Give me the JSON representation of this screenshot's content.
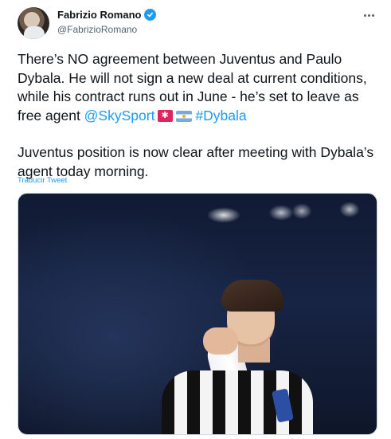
{
  "author": {
    "display_name": "Fabrizio Romano",
    "handle": "@FabrizioRomano",
    "verified": true,
    "avatar_icon": "profile-avatar"
  },
  "menu": {
    "more_icon": "more-horizontal-icon"
  },
  "tweet": {
    "para1_text": "There’s NO agreement between Juventus and Paulo Dybala. He will not sign a new deal at current conditions, while his contract runs out in June - he’s set to leave as free agent ",
    "mention": "@SkySport",
    "hashtag": "#Dybala",
    "emojis": [
      "siren-emoji",
      "argentina-flag-emoji"
    ],
    "para2_text": "Juventus position is now clear after meeting with Dybala’s agent today morning."
  },
  "translate_label": "Traducir Tweet",
  "media": {
    "description_icon": "photo-media"
  },
  "colors": {
    "link": "#1d9bf0",
    "verified": "#1d9bf0",
    "text": "#0f1419",
    "secondary": "#536471"
  }
}
